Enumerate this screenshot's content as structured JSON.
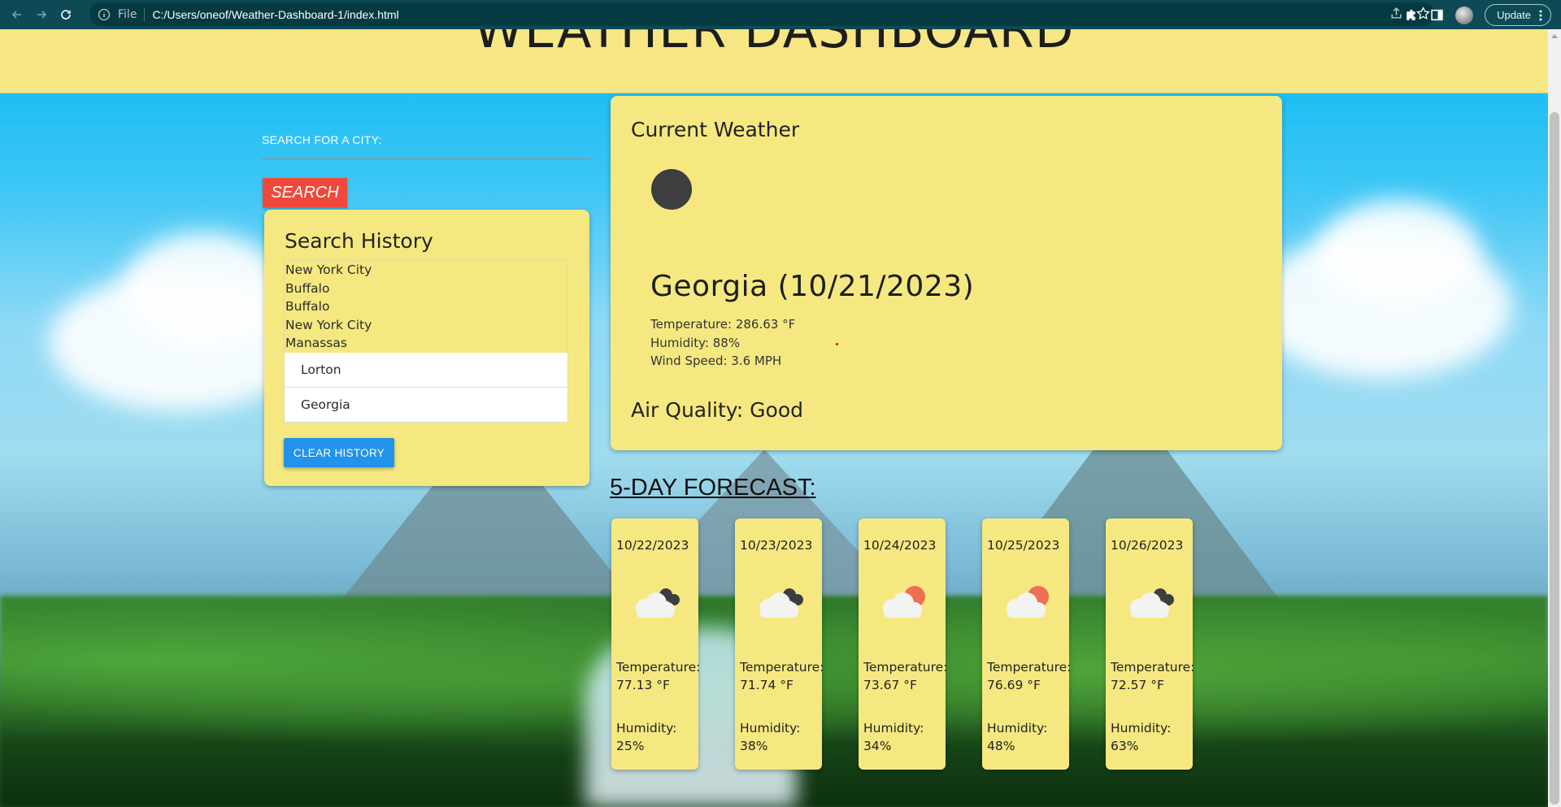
{
  "browser": {
    "scheme_label": "File",
    "url": "C:/Users/oneof/Weather-Dashboard-1/index.html",
    "update_label": "Update"
  },
  "header": {
    "title": "WEATHER DASHBOARD"
  },
  "search": {
    "label": "SEARCH FOR A CITY:",
    "input_value": "",
    "button_label": "SEARCH"
  },
  "history": {
    "title": "Search History",
    "plain_items": [
      "New York City",
      "Buffalo",
      "Buffalo",
      "New York City",
      "Manassas"
    ],
    "boxed_items": [
      "Lorton",
      "Georgia"
    ],
    "clear_label": "CLEAR HISTORY"
  },
  "current": {
    "title": "Current Weather",
    "icon": "dark-circle-icon",
    "city_date": "Georgia (10/21/2023)",
    "temperature": "Temperature: 286.63 °F",
    "humidity": "Humidity: 88%",
    "wind": "Wind Speed: 3.6 MPH",
    "air_quality": "Air Quality: Good"
  },
  "forecast": {
    "heading": "5-DAY FORECAST:",
    "days": [
      {
        "date": "10/22/2023",
        "icon": "cloud-dark-icon",
        "temp_label": "Temperature:",
        "temp_value": "77.13 °F",
        "hum_label": "Humidity:",
        "hum_value": "25%"
      },
      {
        "date": "10/23/2023",
        "icon": "cloud-dark-icon",
        "temp_label": "Temperature:",
        "temp_value": "71.74 °F",
        "hum_label": "Humidity:",
        "hum_value": "38%"
      },
      {
        "date": "10/24/2023",
        "icon": "cloud-sun-icon",
        "temp_label": "Temperature:",
        "temp_value": "73.67 °F",
        "hum_label": "Humidity:",
        "hum_value": "34%"
      },
      {
        "date": "10/25/2023",
        "icon": "cloud-sun-icon",
        "temp_label": "Temperature:",
        "temp_value": "76.69 °F",
        "hum_label": "Humidity:",
        "hum_value": "48%"
      },
      {
        "date": "10/26/2023",
        "icon": "cloud-dark-icon",
        "temp_label": "Temperature:",
        "temp_value": "72.57 °F",
        "hum_label": "Humidity:",
        "hum_value": "63%"
      }
    ]
  },
  "colors": {
    "header_bg": "#f7e784",
    "card_bg": "#f5e880",
    "search_button": "#f2483b",
    "clear_button": "#2293ea",
    "chrome_bg": "#0d4a55"
  }
}
